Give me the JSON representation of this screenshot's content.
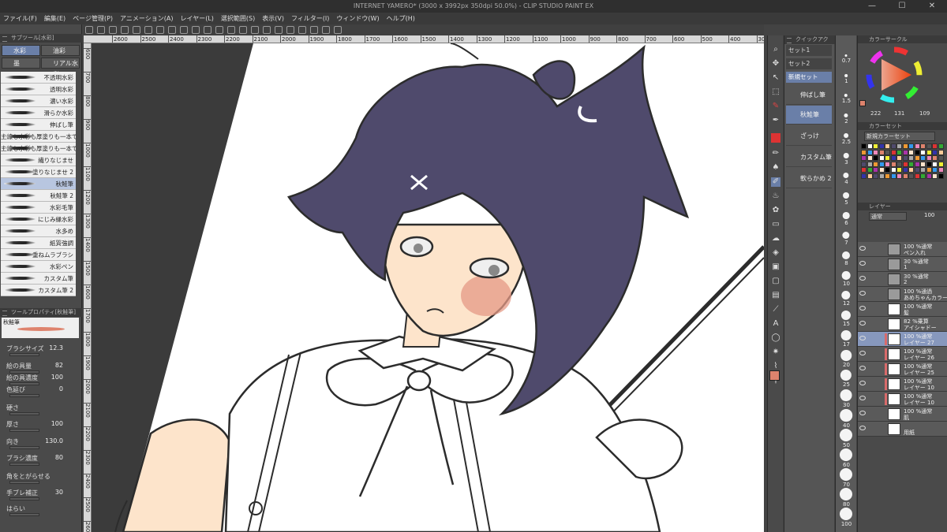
{
  "window": {
    "title": "INTERNET YAMERO* (3000 x 3992px 350dpi 50.0%) - CLIP STUDIO PAINT EX",
    "minimize": "—",
    "maximize": "☐",
    "close": "✕"
  },
  "menu": [
    "ファイル(F)",
    "編集(E)",
    "ページ管理(P)",
    "アニメーション(A)",
    "レイヤー(L)",
    "選択範囲(S)",
    "表示(V)",
    "フィルター(I)",
    "ウィンドウ(W)",
    "ヘルプ(H)"
  ],
  "ruler": {
    "h": [
      "2600",
      "2500",
      "2400",
      "2300",
      "2200",
      "2100",
      "2000",
      "1900",
      "1800",
      "1700",
      "1600",
      "1500",
      "1400",
      "1300",
      "1200",
      "1100",
      "1000",
      "900",
      "800",
      "700",
      "600",
      "500",
      "400",
      "300",
      "200"
    ],
    "v": [
      "600",
      "700",
      "800",
      "900",
      "1000",
      "1100",
      "1200",
      "1300",
      "1400",
      "1500",
      "1600",
      "1700",
      "1800",
      "1900",
      "2000",
      "2100",
      "2200",
      "2300",
      "2400",
      "2500",
      "2600"
    ]
  },
  "subtool": {
    "header": "サブツール[水彩]",
    "groups": [
      "水彩",
      "油彩",
      "墨",
      "リアル水彩"
    ],
    "brushes": [
      "不透明水彩",
      "透明水彩",
      "濃い水彩",
      "滑らか水彩",
      "伸ばし筆",
      "主線も水彩も厚塗りも一本で",
      "主線も水彩も厚塗りも一本で",
      "繊りなじませ",
      "塗りなじませ 2",
      "秋鮭筆",
      "秋鮭筆 2",
      "水彩毛筆",
      "にじみ縁水彩",
      "水多め",
      "紙質強調",
      "重ねムラブラシ",
      "水彩ペン",
      "カスタム筆",
      "カスタム筆 2"
    ],
    "selected_brush": "秋鮭筆"
  },
  "toolprop": {
    "header": "ツールプロパティ[秋鮭筆]",
    "name": "秋鮭筆",
    "rows": [
      {
        "label": "ブラシサイズ",
        "value": "12.3"
      },
      {
        "label": "絵の具量",
        "value": "82"
      },
      {
        "label": "絵の具濃度",
        "value": "100"
      },
      {
        "label": "色延び",
        "value": "0"
      },
      {
        "label": "硬さ",
        "value": ""
      },
      {
        "label": "厚さ",
        "value": "100"
      },
      {
        "label": "向き",
        "value": "130.0"
      },
      {
        "label": "ブラシ濃度",
        "value": "80"
      },
      {
        "label": "角をとがらせる",
        "value": ""
      },
      {
        "label": "手ブレ補正",
        "value": "30"
      },
      {
        "label": "はらい",
        "value": ""
      }
    ]
  },
  "quick": {
    "header": "クイックアク",
    "sets": [
      "セット1",
      "セット2",
      "新規セット"
    ],
    "items": [
      "伸ばし筆",
      "秋鮭筆",
      "ざっけ",
      "カスタム筆",
      "軟らかめ 2"
    ],
    "selected": "秋鮭筆"
  },
  "brushsizes": [
    "0.7",
    "1",
    "1.5",
    "2",
    "2.5",
    "3",
    "4",
    "5",
    "6",
    "7",
    "8",
    "10",
    "12",
    "15",
    "17",
    "20",
    "25",
    "30",
    "40",
    "50",
    "60",
    "70",
    "80",
    "100"
  ],
  "colorwheel": {
    "header": "カラーサークル",
    "r": "222",
    "g": "131",
    "b": "109",
    "current": "#de836d"
  },
  "colorset": {
    "header": "カラーセット",
    "name": "新規カラーセット"
  },
  "layers": {
    "header": "レイヤー",
    "blend": "通常",
    "opacity": "100",
    "items": [
      {
        "pct": "100 %通常",
        "name": "ペン入れ",
        "folder": true
      },
      {
        "pct": "30 %通常",
        "name": "1",
        "folder": true
      },
      {
        "pct": "30 %通常",
        "name": "2",
        "folder": true
      },
      {
        "pct": "100 %通過",
        "name": "あめちゃんカラー",
        "folder": true
      },
      {
        "pct": "100 %通常",
        "name": "髪",
        "folder": false
      },
      {
        "pct": "82 %乗算",
        "name": "アイシャドー",
        "folder": false
      },
      {
        "pct": "100 %通常",
        "name": "レイヤー 27",
        "folder": false
      },
      {
        "pct": "100 %通常",
        "name": "レイヤー 26",
        "folder": false
      },
      {
        "pct": "100 %通常",
        "name": "レイヤー 25",
        "folder": false
      },
      {
        "pct": "100 %通常",
        "name": "レイヤー 10",
        "folder": false
      },
      {
        "pct": "100 %通常",
        "name": "レイヤー 10",
        "folder": false
      },
      {
        "pct": "100 %通常",
        "name": "肌",
        "folder": false
      },
      {
        "pct": "",
        "name": "用紙",
        "folder": false
      }
    ],
    "selected": "レイヤー 27"
  },
  "colors": {
    "hair": "#4f4a6c",
    "skin": "#fde4cb",
    "blush": "#e49a86",
    "line": "#2c2c2c",
    "selection": "#6a7fa8"
  }
}
